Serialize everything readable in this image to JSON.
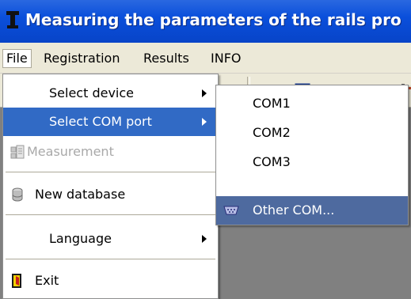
{
  "window": {
    "title": "Measuring the parameters of the rails pro",
    "accent": "#0a4fdb"
  },
  "menubar": {
    "items": [
      {
        "label": "File"
      },
      {
        "label": "Registration"
      },
      {
        "label": "Results"
      },
      {
        "label": "INFO"
      }
    ]
  },
  "file_menu": {
    "items": [
      {
        "label": "Select device",
        "has_submenu": true
      },
      {
        "label": "Select COM port",
        "has_submenu": true,
        "highlighted": true
      },
      {
        "label": "Measurement",
        "disabled": true,
        "icon": "measurement-icon"
      },
      {
        "label": "New database",
        "icon": "database-icon"
      },
      {
        "label": "Language",
        "has_submenu": true
      },
      {
        "label": "Exit",
        "icon": "exit-door-icon"
      }
    ]
  },
  "com_submenu": {
    "items": [
      {
        "label": "COM1"
      },
      {
        "label": "COM2"
      },
      {
        "label": "COM3"
      },
      {
        "label": "Other COM...",
        "icon": "serial-port-icon",
        "highlighted": true
      }
    ]
  }
}
